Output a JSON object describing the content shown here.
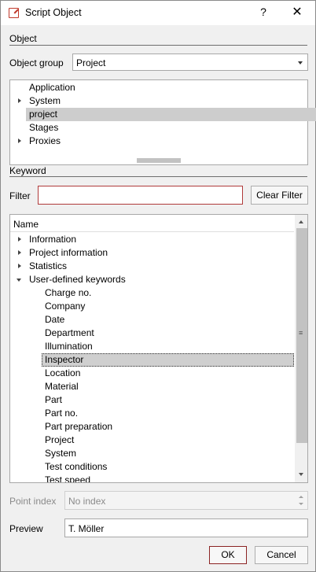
{
  "window": {
    "title": "Script Object",
    "help_symbol": "?",
    "close_symbol": "✕"
  },
  "object_section": {
    "label": "Object",
    "group_label": "Object group",
    "group_value": "Project",
    "tree": [
      {
        "label": "Application",
        "expander": "none"
      },
      {
        "label": "System",
        "expander": "collapsed"
      },
      {
        "label": "project",
        "expander": "none",
        "selected": true
      },
      {
        "label": "Stages",
        "expander": "none"
      },
      {
        "label": "Proxies",
        "expander": "collapsed"
      }
    ]
  },
  "keyword_section": {
    "label": "Keyword",
    "filter_label": "Filter",
    "filter_value": "",
    "clear_filter_label": "Clear Filter",
    "column_header": "Name",
    "items": [
      {
        "label": "Information",
        "level": 0,
        "expander": "collapsed"
      },
      {
        "label": "Project information",
        "level": 0,
        "expander": "collapsed"
      },
      {
        "label": "Statistics",
        "level": 0,
        "expander": "collapsed"
      },
      {
        "label": "User-defined keywords",
        "level": 0,
        "expander": "expanded"
      },
      {
        "label": "Charge no.",
        "level": 1
      },
      {
        "label": "Company",
        "level": 1
      },
      {
        "label": "Date",
        "level": 1
      },
      {
        "label": "Department",
        "level": 1
      },
      {
        "label": "Illumination",
        "level": 1
      },
      {
        "label": "Inspector",
        "level": 1,
        "selected": true
      },
      {
        "label": "Location",
        "level": 1
      },
      {
        "label": "Material",
        "level": 1
      },
      {
        "label": "Part",
        "level": 1
      },
      {
        "label": "Part no.",
        "level": 1
      },
      {
        "label": "Part preparation",
        "level": 1
      },
      {
        "label": "Project",
        "level": 1
      },
      {
        "label": "System",
        "level": 1
      },
      {
        "label": "Test conditions",
        "level": 1
      },
      {
        "label": "Test speed",
        "level": 1
      }
    ]
  },
  "point_index": {
    "label": "Point index",
    "placeholder": "No index"
  },
  "preview": {
    "label": "Preview",
    "value": "T. Möller"
  },
  "buttons": {
    "ok": "OK",
    "cancel": "Cancel"
  },
  "colors": {
    "accent": "#b03a3a",
    "selection": "#cdcdcd"
  }
}
